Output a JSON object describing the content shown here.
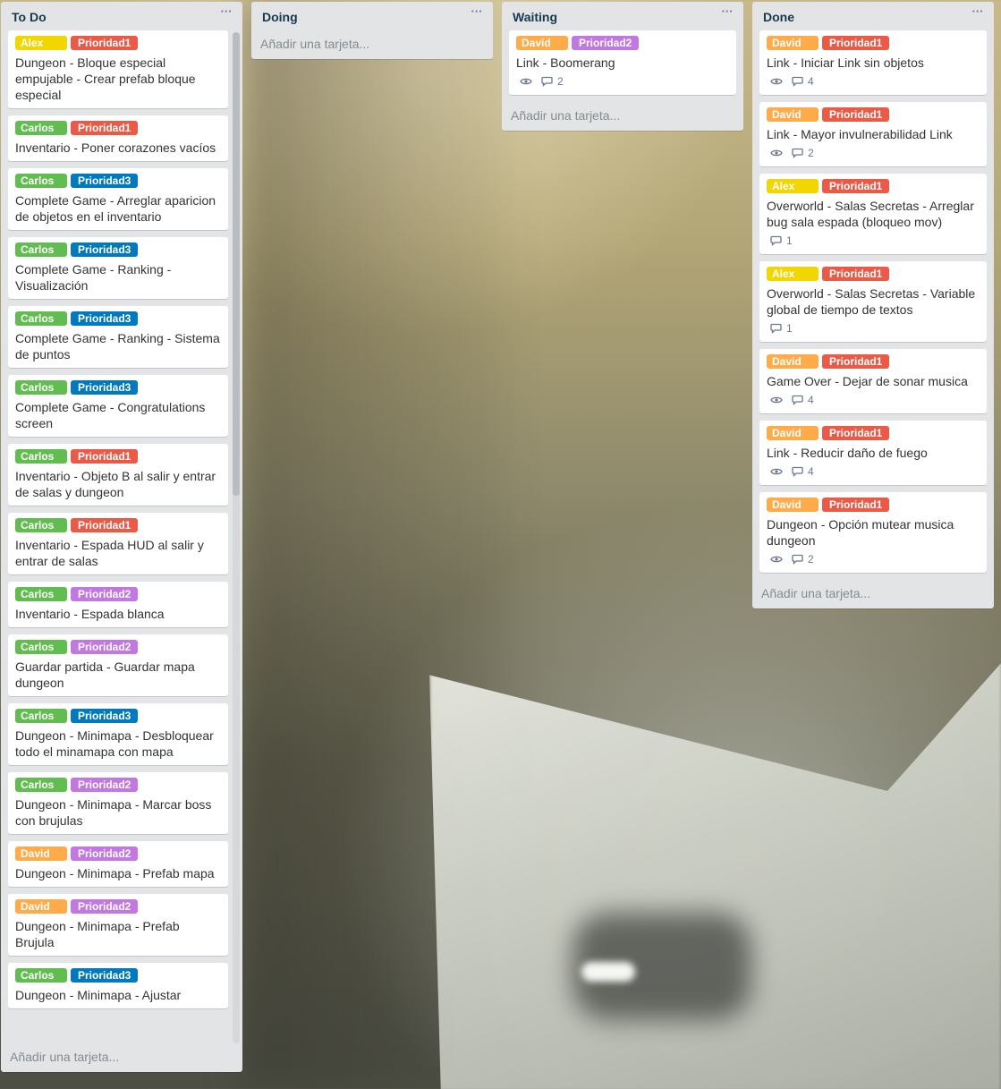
{
  "colors": {
    "Alex": "#f2d600",
    "Carlos": "#61bd4f",
    "David": "#ffab4a",
    "Prioridad1": "#eb5a46",
    "Prioridad2": "#c377e0",
    "Prioridad3": "#0079bf"
  },
  "add_card_label": "Añadir una tarjeta...",
  "lists": [
    {
      "title": "To Do",
      "menu": "···",
      "cards": [
        {
          "labels": [
            "Alex",
            "Prioridad1"
          ],
          "title": "Dungeon - Bloque especial empujable - Crear prefab bloque especial"
        },
        {
          "labels": [
            "Carlos",
            "Prioridad1"
          ],
          "title": "Inventario - Poner corazones vacíos"
        },
        {
          "labels": [
            "Carlos",
            "Prioridad3"
          ],
          "title": "Complete Game - Arreglar aparicion de objetos en el inventario"
        },
        {
          "labels": [
            "Carlos",
            "Prioridad3"
          ],
          "title": "Complete Game - Ranking - Visualización"
        },
        {
          "labels": [
            "Carlos",
            "Prioridad3"
          ],
          "title": "Complete Game - Ranking - Sistema de puntos"
        },
        {
          "labels": [
            "Carlos",
            "Prioridad3"
          ],
          "title": "Complete Game - Congratulations screen"
        },
        {
          "labels": [
            "Carlos",
            "Prioridad1"
          ],
          "title": "Inventario - Objeto B al salir y entrar de salas y dungeon"
        },
        {
          "labels": [
            "Carlos",
            "Prioridad1"
          ],
          "title": "Inventario - Espada HUD al salir y entrar de salas"
        },
        {
          "labels": [
            "Carlos",
            "Prioridad2"
          ],
          "title": "Inventario - Espada blanca"
        },
        {
          "labels": [
            "Carlos",
            "Prioridad2"
          ],
          "title": "Guardar partida - Guardar mapa dungeon"
        },
        {
          "labels": [
            "Carlos",
            "Prioridad3"
          ],
          "title": "Dungeon - Minimapa - Desbloquear todo el minamapa con mapa"
        },
        {
          "labels": [
            "Carlos",
            "Prioridad2"
          ],
          "title": "Dungeon - Minimapa - Marcar boss con brujulas"
        },
        {
          "labels": [
            "David",
            "Prioridad2"
          ],
          "title": "Dungeon - Minimapa - Prefab mapa"
        },
        {
          "labels": [
            "David",
            "Prioridad2"
          ],
          "title": "Dungeon - Minimapa - Prefab Brujula"
        },
        {
          "labels": [
            "Carlos",
            "Prioridad3"
          ],
          "title": "Dungeon - Minimapa - Ajustar"
        }
      ]
    },
    {
      "title": "Doing",
      "menu": "···",
      "cards": []
    },
    {
      "title": "Waiting",
      "menu": "···",
      "cards": [
        {
          "labels": [
            "David",
            "Prioridad2"
          ],
          "title": "Link - Boomerang",
          "watch": true,
          "comments": "2"
        }
      ]
    },
    {
      "title": "Done",
      "menu": "···",
      "cards": [
        {
          "labels": [
            "David",
            "Prioridad1"
          ],
          "title": "Link - Iniciar Link sin objetos",
          "watch": true,
          "comments": "4"
        },
        {
          "labels": [
            "David",
            "Prioridad1"
          ],
          "title": "Link - Mayor invulnerabilidad Link",
          "watch": true,
          "comments": "2"
        },
        {
          "labels": [
            "Alex",
            "Prioridad1"
          ],
          "title": "Overworld - Salas Secretas - Arreglar bug sala espada (bloqueo mov)",
          "watch": false,
          "comments": "1"
        },
        {
          "labels": [
            "Alex",
            "Prioridad1"
          ],
          "title": "Overworld - Salas Secretas - Variable global de tiempo de textos",
          "watch": false,
          "comments": "1"
        },
        {
          "labels": [
            "David",
            "Prioridad1"
          ],
          "title": "Game Over - Dejar de sonar musica",
          "watch": true,
          "comments": "4"
        },
        {
          "labels": [
            "David",
            "Prioridad1"
          ],
          "title": "Link - Reducir daño de fuego",
          "watch": true,
          "comments": "4"
        },
        {
          "labels": [
            "David",
            "Prioridad1"
          ],
          "title": "Dungeon - Opción mutear musica dungeon",
          "watch": true,
          "comments": "2"
        }
      ]
    }
  ]
}
